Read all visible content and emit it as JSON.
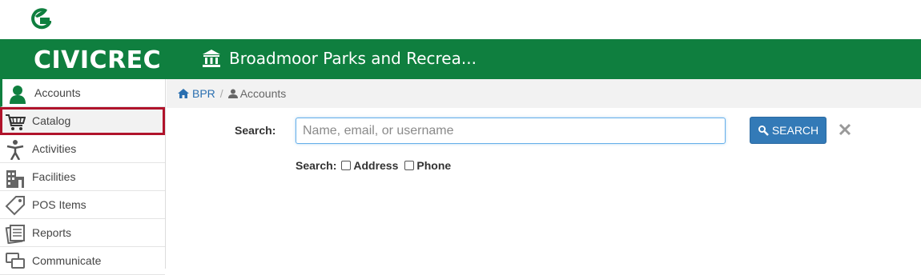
{
  "app": {
    "brand": "CIVICREC",
    "org_name": "Broadmoor Parks and Recrea...",
    "accent": "#0f7f3f"
  },
  "sidebar": {
    "items": [
      {
        "label": "Accounts",
        "icon": "person-icon"
      },
      {
        "label": "Catalog",
        "icon": "cart-icon"
      },
      {
        "label": "Activities",
        "icon": "activity-person-icon"
      },
      {
        "label": "Facilities",
        "icon": "building-icon"
      },
      {
        "label": "POS Items",
        "icon": "tag-icon"
      },
      {
        "label": "Reports",
        "icon": "reports-icon"
      },
      {
        "label": "Communicate",
        "icon": "chat-icon"
      }
    ]
  },
  "breadcrumb": {
    "home": "BPR",
    "current": "Accounts"
  },
  "search": {
    "label": "Search:",
    "placeholder": "Name, email, or username",
    "value": "",
    "button": "SEARCH",
    "options_label": "Search:",
    "options": [
      "Address",
      "Phone"
    ]
  }
}
